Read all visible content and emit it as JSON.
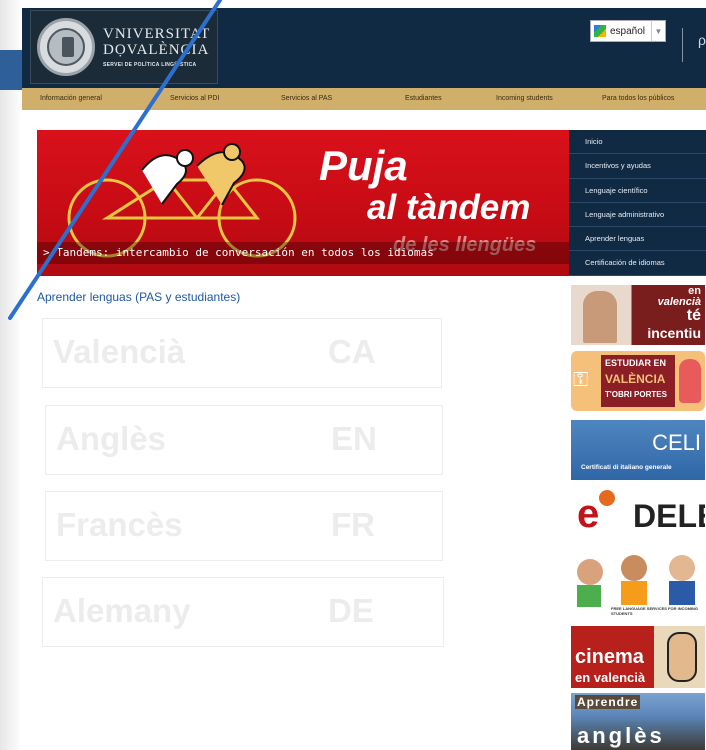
{
  "header": {
    "university_line1": "VNIVERSITAT",
    "university_line2": "DỌVALÈNCIA",
    "university_line3": "SERVEI DE POLÍTICA LINGÜÍSTICA",
    "language": "español",
    "search_fragment": "ρ"
  },
  "nav": {
    "items": [
      "Información general",
      "Servicios al PDI",
      "Servicios al PAS",
      "Estudiantes",
      "Incoming students",
      "Para todos los públicos"
    ]
  },
  "banner": {
    "title_line1": "Puja",
    "title_line2": "al tàndem",
    "title_line3": "de les llengües",
    "caption": "> Tandems: intercambio de conversación en todos los idiomas"
  },
  "side_menu": {
    "items": [
      "Inicio",
      "Incentivos y ayudas",
      "Lenguaje científico",
      "Lenguaje administrativo",
      "Aprender lenguas",
      "Certificación de idiomas"
    ]
  },
  "main": {
    "title": "Aprender lenguas (PAS y estudiantes)",
    "cards": [
      {
        "name": "Valencià",
        "code": "CA"
      },
      {
        "name": "Anglès",
        "code": "EN"
      },
      {
        "name": "Francès",
        "code": "FR"
      },
      {
        "name": "Alemany",
        "code": "DE"
      }
    ]
  },
  "ads": {
    "valencia_incentiu": {
      "line1": "en",
      "line2": "valencià",
      "line3": "té",
      "line4": "incentiu"
    },
    "estudiar": {
      "line1": "ESTUDIAR EN",
      "line2": "VALÈNCIA",
      "line3": "T'OBRI PORTES"
    },
    "celi": {
      "title": "CELI",
      "subtitle": "Certificati di italiano generale"
    },
    "dele": {
      "prefix": "e",
      "title": "DELE"
    },
    "free_language": {
      "text": "FREE LANGUAGE SERVICES FOR INCOMING STUDENTS"
    },
    "cinema": {
      "line1": "cinema",
      "line2": "en valencià"
    },
    "aprendre": {
      "line1": "Aprendre",
      "line2": "anglès"
    }
  }
}
